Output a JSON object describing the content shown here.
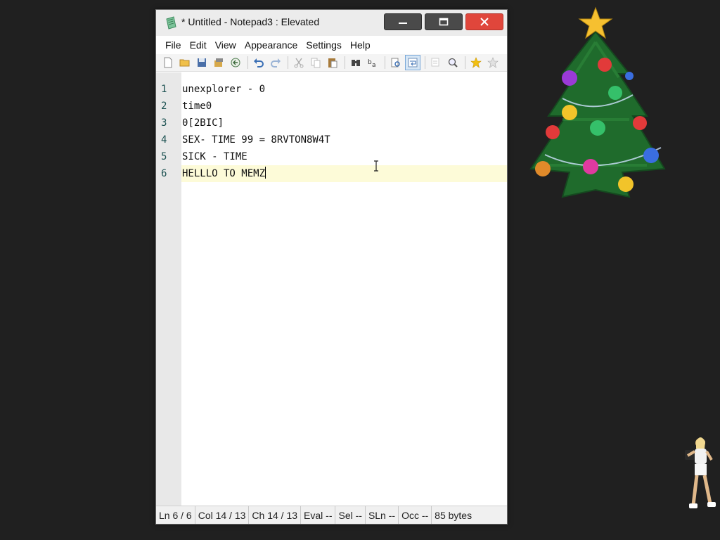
{
  "window": {
    "title": "* Untitled - Notepad3 : Elevated",
    "buttons": {
      "minimize": "minimize",
      "maximize": "maximize",
      "close": "close"
    }
  },
  "menu": [
    "File",
    "Edit",
    "View",
    "Appearance",
    "Settings",
    "Help"
  ],
  "toolbar_icons": [
    "new-file-icon",
    "open-folder-icon",
    "save-icon",
    "save-as-icon",
    "revert-icon",
    "undo-icon",
    "redo-icon",
    "cut-icon",
    "copy-icon",
    "paste-icon",
    "find-icon",
    "replace-icon",
    "find-in-files-icon",
    "word-wrap-icon",
    "zoom-out-icon",
    "zoom-in-icon",
    "favorite-icon",
    "add-favorite-icon"
  ],
  "editor": {
    "lines": [
      {
        "num": "1",
        "text": "unexplorer - 0"
      },
      {
        "num": "2",
        "text": "time0"
      },
      {
        "num": "3",
        "text": "0[2BIC]"
      },
      {
        "num": "4",
        "text": "SEX- TIME 99 = 8RVTON8W4T"
      },
      {
        "num": "5",
        "text": "SICK - TIME"
      },
      {
        "num": "6",
        "text": "HELLLO TO MEMZ"
      }
    ],
    "current_line": 6
  },
  "status": {
    "ln": "Ln  6 / 6",
    "col": "Col  14 / 13",
    "ch": "Ch  14 / 13",
    "eval": "Eval  --",
    "sel": "Sel  --",
    "sln": "SLn  --",
    "occ": "Occ  --",
    "bytes": "85 bytes"
  },
  "colors": {
    "desktop": "#202020",
    "close_button": "#e0463b",
    "line_numbers": "#1d5252",
    "current_line_highlight": "#fdfbd8"
  }
}
